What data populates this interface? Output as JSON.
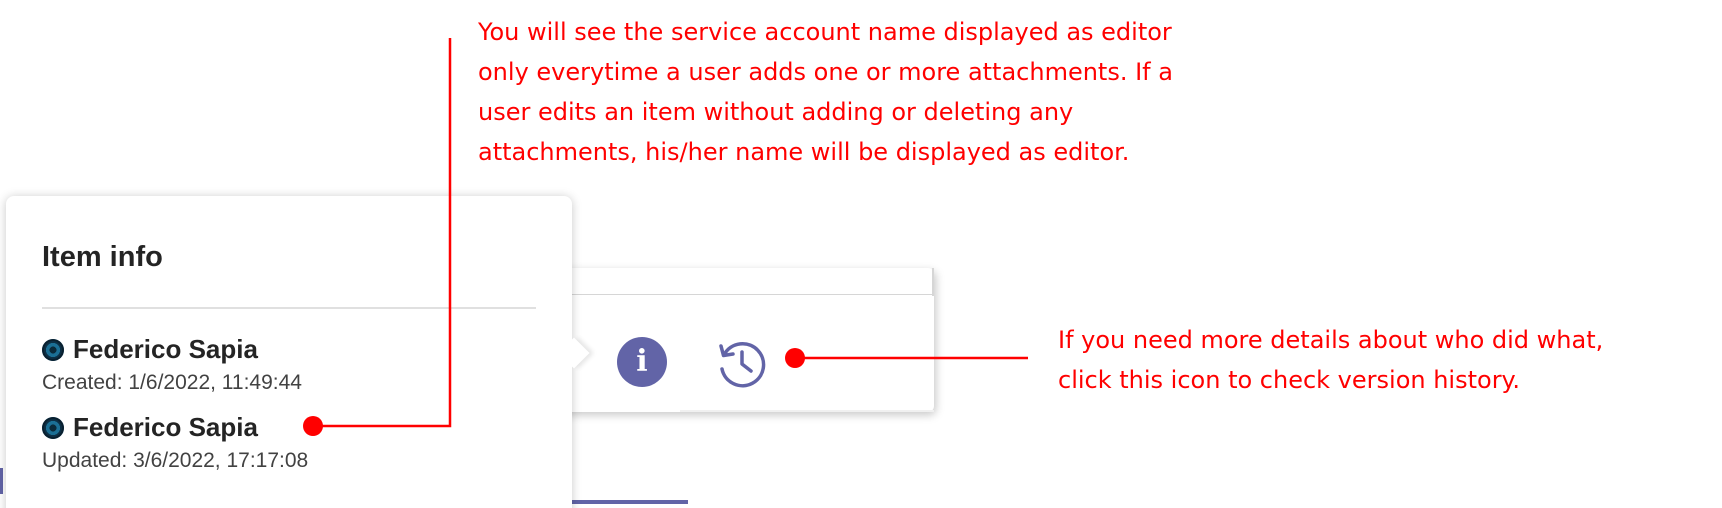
{
  "popup": {
    "title": "Item info",
    "entries": [
      {
        "name": "Federico Sapia",
        "meta": "Created: 1/6/2022, 11:49:44"
      },
      {
        "name": "Federico Sapia",
        "meta": "Updated: 3/6/2022, 17:17:08"
      }
    ]
  },
  "toolbar": {
    "info_glyph": "i",
    "info_icon": "info-icon",
    "history_icon": "version-history-icon"
  },
  "annotations": {
    "top": [
      "You will see the service account name displayed as editor",
      "only everytime a user adds one or more attachments. If a",
      "user edits an item without adding or deleting any",
      "attachments, his/her name will be displayed as editor."
    ],
    "right": [
      "If you need more details about who did what,",
      "click this icon to check version history."
    ]
  },
  "colors": {
    "annotation": "#ff0000",
    "accent": "#6264a7",
    "text_primary": "#242424"
  }
}
